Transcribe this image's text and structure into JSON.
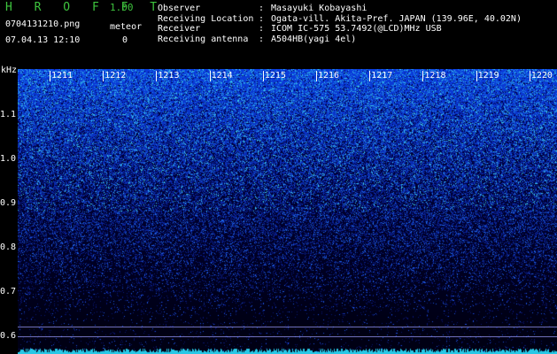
{
  "header": {
    "app_name": "H R O F F T",
    "version": "1.00",
    "filename": "0704131210.png",
    "datetime": "07.04.13 12:10",
    "meteor_label": "meteor",
    "meteor_count": "0"
  },
  "meta": [
    {
      "key": "Observer",
      "value": "Masayuki Kobayashi"
    },
    {
      "key": "Receiving Location",
      "value": "Ogata-vill. Akita-Pref. JAPAN (139.96E, 40.02N)"
    },
    {
      "key": "Receiver",
      "value": "ICOM IC-575 53.7492(@LCD)MHz USB"
    },
    {
      "key": "Receiving antenna",
      "value": "A504HB(yagi 4el)"
    }
  ],
  "spectrogram": {
    "y_unit": "kHz",
    "y_ticks": [
      "1.1",
      "1.0",
      "0.9",
      "0.8",
      "0.7",
      "0.6"
    ],
    "x_ticks": [
      "1211",
      "1212",
      "1213",
      "1214",
      "1215",
      "1216",
      "1217",
      "1218",
      "1219",
      "1220"
    ]
  }
}
